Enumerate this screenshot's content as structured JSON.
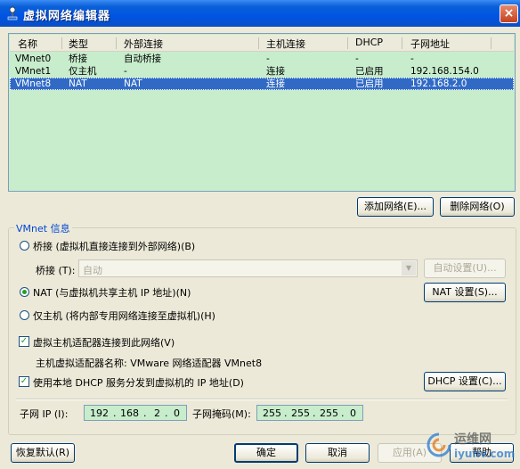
{
  "window": {
    "title": "虚拟网络编辑器",
    "close_label": "×"
  },
  "table": {
    "headers": [
      "名称",
      "类型",
      "外部连接",
      "主机连接",
      "DHCP",
      "子网地址"
    ],
    "rows": [
      [
        "VMnet0",
        "桥接",
        "自动桥接",
        "-",
        "-",
        "-"
      ],
      [
        "VMnet1",
        "仅主机",
        "-",
        "连接",
        "已启用",
        "192.168.154.0"
      ],
      [
        "VMnet8",
        "NAT",
        "NAT",
        "连接",
        "已启用",
        "192.168.2.0"
      ]
    ],
    "selected_index": 2
  },
  "buttons": {
    "add_network": "添加网络(E)...",
    "remove_network": "删除网络(O)",
    "auto_settings": "自动设置(U)...",
    "nat_settings": "NAT 设置(S)...",
    "dhcp_settings": "DHCP 设置(C)...",
    "restore_defaults": "恢复默认(R)",
    "ok": "确定",
    "cancel": "取消",
    "apply": "应用(A)",
    "help": "帮助"
  },
  "vmnet_info": {
    "group_title": "VMnet 信息",
    "bridged_label": "桥接 (虚拟机直接连接到外部网络)(B)",
    "bridged_to_label": "桥接 (T):",
    "bridged_to_value": "自动",
    "nat_label": "NAT (与虚拟机共享主机 IP 地址)(N)",
    "hostonly_label": "仅主机 (将内部专用网络连接至虚拟机)(H)",
    "selected_mode": "nat",
    "connect_adapter_label": "虚拟主机适配器连接到此网络(V)",
    "connect_adapter_checked": true,
    "adapter_name_label": "主机虚拟适配器名称: VMware 网络适配器 VMnet8",
    "use_dhcp_label": "使用本地 DHCP 服务分发到虚拟机的 IP 地址(D)",
    "use_dhcp_checked": true,
    "subnet_ip_label": "子网 IP (I):",
    "subnet_ip": [
      "192",
      "168",
      "2",
      "0"
    ],
    "subnet_mask_label": "子网掩码(M):",
    "subnet_mask": [
      "255",
      "255",
      "255",
      "0"
    ]
  },
  "watermark": {
    "text": "运维网",
    "subtext": "iyunv.com"
  },
  "colors": {
    "title_bar": "#0054e3",
    "list_bg": "#c7edcc",
    "selection": "#316ac5",
    "dialog_bg": "#ece9d8"
  }
}
